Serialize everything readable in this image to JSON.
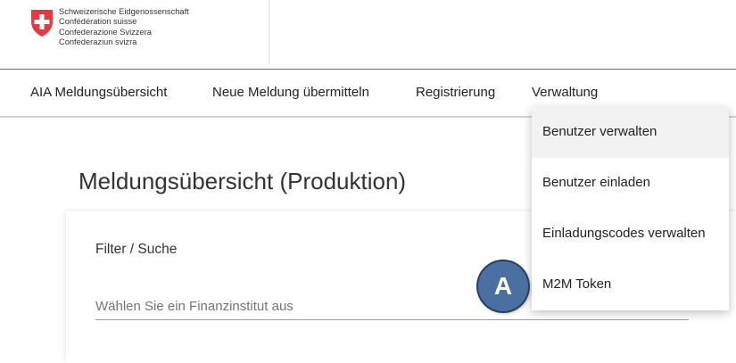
{
  "header": {
    "country_names": [
      "Schweizerische Eidgenossenschaft",
      "Confédération suisse",
      "Confederazione Svizzera",
      "Confederaziun svizra"
    ]
  },
  "nav": {
    "items": [
      {
        "label": "AIA Meldungsübersicht"
      },
      {
        "label": "Neue Meldung übermitteln"
      },
      {
        "label": "Registrierung"
      },
      {
        "label": "Verwaltung"
      }
    ]
  },
  "main": {
    "title": "Meldungsübersicht (Produktion)",
    "filter": {
      "label": "Filter / Suche",
      "placeholder": "Wählen Sie ein Finanzinstitut aus"
    }
  },
  "menu": {
    "items": [
      {
        "label": "Benutzer verwalten",
        "active": true
      },
      {
        "label": "Benutzer einladen"
      },
      {
        "label": "Einladungscodes verwalten"
      },
      {
        "label": "M2M Token"
      }
    ]
  },
  "callout": {
    "label": "A"
  },
  "colors": {
    "brand_red": "#e53940",
    "badge_blue": "#4a6fa1"
  }
}
